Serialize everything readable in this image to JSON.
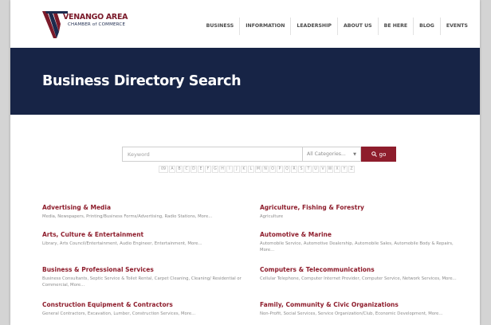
{
  "header": {
    "logo": {
      "name": "VENANGO AREA",
      "sub": "CHAMBER of COMMERCE"
    },
    "nav": [
      "BUSINESS",
      "INFORMATION",
      "LEADERSHIP",
      "ABOUT US",
      "BE HERE",
      "BLOG",
      "EVENTS"
    ]
  },
  "hero": {
    "title": "Business Directory Search"
  },
  "search": {
    "keyword_placeholder": "Keyword",
    "category_value": "All Categories...",
    "go_label": "go"
  },
  "alphabet": [
    "09",
    "A",
    "B",
    "C",
    "D",
    "E",
    "F",
    "G",
    "H",
    "I",
    "J",
    "K",
    "L",
    "M",
    "N",
    "O",
    "P",
    "Q",
    "R",
    "S",
    "T",
    "U",
    "V",
    "W",
    "X",
    "Y",
    "Z"
  ],
  "categories": [
    {
      "title": "Advertising & Media",
      "desc": "Media, Newspapers, Printing/Business Forms/Advertising, Radio Stations, More..."
    },
    {
      "title": "Agriculture, Fishing & Forestry",
      "desc": "Agriculture"
    },
    {
      "title": "Arts, Culture & Entertainment",
      "desc": "Library, Arts Council/Entertainment, Audio Engineer, Entertainment, More..."
    },
    {
      "title": "Automotive & Marine",
      "desc": "Automobile Service, Automotive Dealership, Automobile Sales, Automobile Body & Repairs, More..."
    },
    {
      "title": "Business & Professional Services",
      "desc": "Business Consultants, Septic Service & Toilet Rental, Carpet Cleaning, Cleaning/ Residential or Commercial, More..."
    },
    {
      "title": "Computers & Telecommunications",
      "desc": "Cellular Telephone, Computer Internet Provider, Computer Service, Network Services, More..."
    },
    {
      "title": "Construction Equipment & Contractors",
      "desc": "General Contractors, Excavation, Lumber, Construction Services, More..."
    },
    {
      "title": "Family, Community & Civic Organizations",
      "desc": "Non-Profit, Social Services, Service Organization/Club, Economic Development, More..."
    }
  ],
  "colors": {
    "navy": "#172446",
    "maroon": "#8e1d2c",
    "link": "#8e1d2c"
  },
  "icons": {
    "search": "search-icon",
    "dropdown": "chevron-down-icon"
  }
}
